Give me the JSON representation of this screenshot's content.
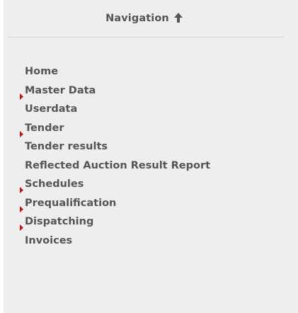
{
  "navigation": {
    "title": "Navigation",
    "collapse_icon": "arrow-up-icon",
    "items": [
      {
        "label": "Home",
        "expandable": false
      },
      {
        "label": "Master Data",
        "expandable": true
      },
      {
        "label": "Userdata",
        "expandable": false
      },
      {
        "label": "Tender",
        "expandable": true
      },
      {
        "label": "Tender results",
        "expandable": false
      },
      {
        "label": "Reflected Auction Result Report",
        "expandable": false
      },
      {
        "label": "Schedules",
        "expandable": true
      },
      {
        "label": "Prequalification",
        "expandable": true
      },
      {
        "label": "Dispatching",
        "expandable": true
      },
      {
        "label": "Invoices",
        "expandable": false
      }
    ]
  },
  "colors": {
    "panel_background": "#eeeeee",
    "text": "#555555",
    "caret": "#cc1111",
    "divider": "#d6d6d6"
  }
}
